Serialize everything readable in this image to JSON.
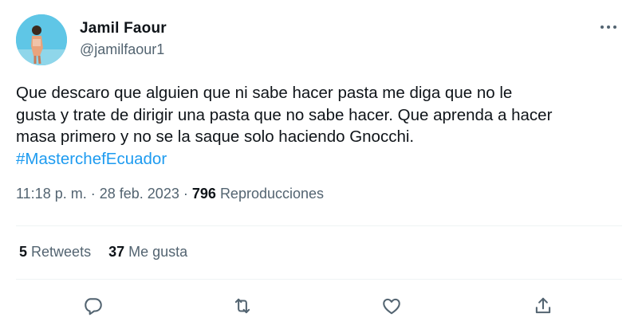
{
  "author": {
    "name": "Jamil Faour",
    "handle": "@jamilfaour1"
  },
  "tweet": {
    "lines": [
      "Que descaro que alguien que ni sabe hacer pasta me diga que no le",
      "gusta y trate de dirigir una pasta que no sabe hacer. Que aprenda a hacer",
      "masa primero y no se la saque solo haciendo Gnocchi."
    ],
    "hashtag": "#MasterchefEcuador"
  },
  "meta": {
    "time": "11:18 p. m.",
    "separator": "·",
    "date": "28 feb. 2023",
    "views_count": "796",
    "views_label": "Reproducciones"
  },
  "stats": {
    "retweets_count": "5",
    "retweets_label": "Retweets",
    "likes_count": "37",
    "likes_label": "Me gusta"
  },
  "icons": {
    "more": "more-icon",
    "reply": "reply-icon",
    "retweet": "retweet-icon",
    "like": "heart-icon",
    "share": "share-icon"
  },
  "colors": {
    "hashtag": "#1d9bf0",
    "secondary_text": "#536471",
    "primary_text": "#0f1419",
    "avatar_bg": "#5dc3e4"
  }
}
